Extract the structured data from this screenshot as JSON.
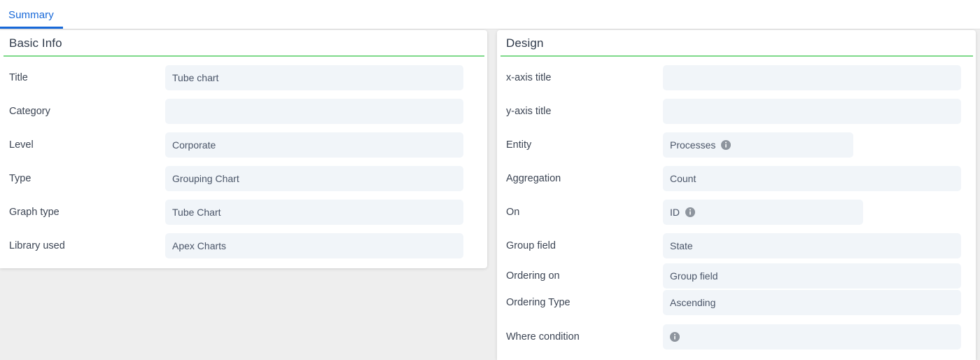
{
  "tabs": [
    {
      "label": "Summary",
      "active": true
    }
  ],
  "colors": {
    "tab_accent": "#1768d8",
    "header_rule": "#7ed98a",
    "field_background": "#f1f5f9",
    "page_background": "#eeeeee",
    "label_text": "#3c4554",
    "value_text": "#4a5568"
  },
  "icons": {
    "info": "info-icon"
  },
  "panels": {
    "basic_info": {
      "title": "Basic Info",
      "rows": [
        {
          "label": "Title",
          "value": "Tube chart",
          "info": false
        },
        {
          "label": "Category",
          "value": "",
          "info": false
        },
        {
          "label": "Level",
          "value": "Corporate",
          "info": false
        },
        {
          "label": "Type",
          "value": "Grouping Chart",
          "info": false
        },
        {
          "label": "Graph type",
          "value": "Tube Chart",
          "info": false
        },
        {
          "label": "Library used",
          "value": "Apex Charts",
          "info": false
        }
      ]
    },
    "design": {
      "title": "Design",
      "rows": [
        {
          "label": "x-axis title",
          "value": "",
          "info": false
        },
        {
          "label": "y-axis title",
          "value": "",
          "info": false
        },
        {
          "label": "Entity",
          "value": "Processes",
          "info": true
        },
        {
          "label": "Aggregation",
          "value": "Count",
          "info": false
        },
        {
          "label": "On",
          "value": "ID",
          "info": true
        },
        {
          "label": "Group field",
          "value": "State",
          "info": false
        },
        {
          "label": "Ordering on",
          "value": "Group field",
          "info": false
        },
        {
          "label": "Ordering Type",
          "value": "Ascending",
          "info": false
        },
        {
          "label": "Where condition",
          "value": "",
          "info": true
        }
      ]
    }
  }
}
